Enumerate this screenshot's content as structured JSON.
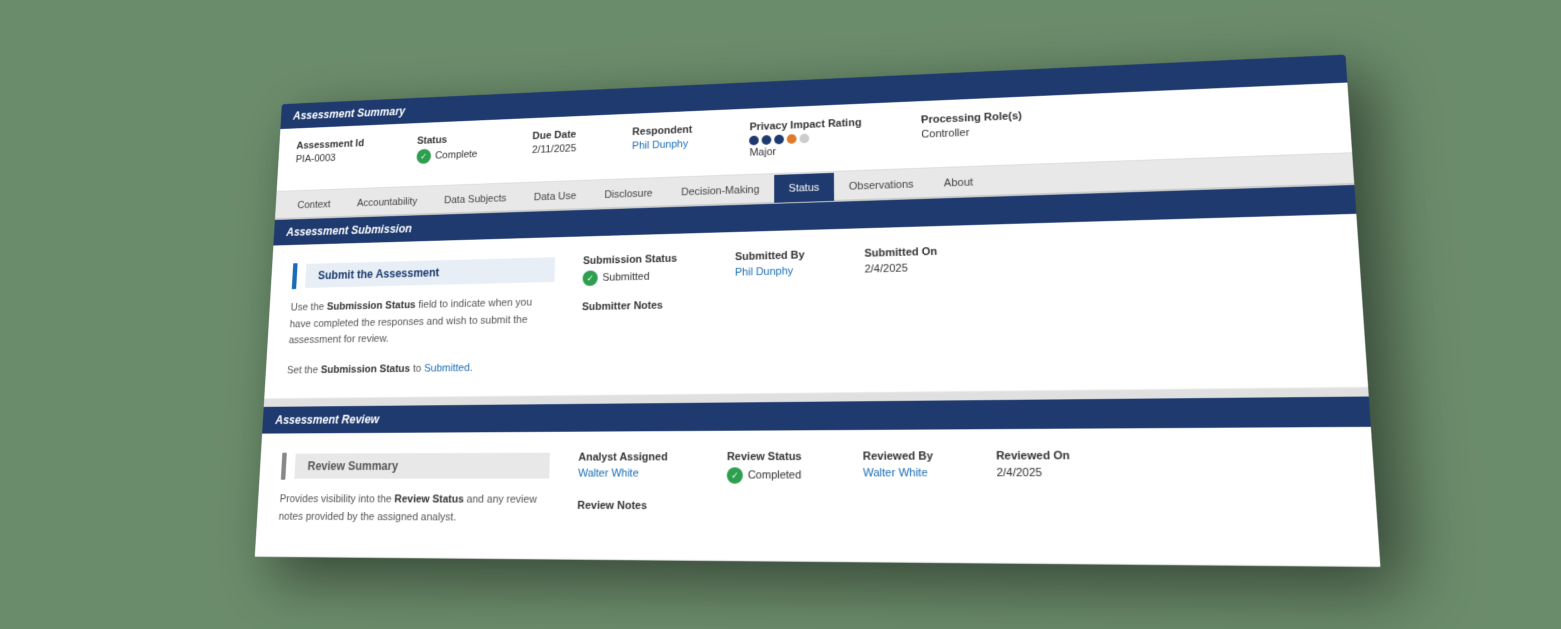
{
  "assessmentSummary": {
    "header": "Assessment Summary",
    "fields": {
      "assessmentId": {
        "label": "Assessment Id",
        "value": "PIA-0003"
      },
      "status": {
        "label": "Status",
        "value": "Complete"
      },
      "dueDate": {
        "label": "Due Date",
        "value": "2/11/2025"
      },
      "respondent": {
        "label": "Respondent",
        "value": "Phil Dunphy"
      },
      "privacyImpactRating": {
        "label": "Privacy Impact Rating",
        "ratingText": "Major",
        "dots": [
          "filled",
          "filled",
          "filled",
          "orange",
          "empty",
          "empty"
        ]
      },
      "processingRoles": {
        "label": "Processing Role(s)",
        "value": "Controller"
      }
    }
  },
  "navigation": {
    "tabs": [
      {
        "label": "Context",
        "active": false
      },
      {
        "label": "Accountability",
        "active": false
      },
      {
        "label": "Data Subjects",
        "active": false
      },
      {
        "label": "Data Use",
        "active": false
      },
      {
        "label": "Disclosure",
        "active": false
      },
      {
        "label": "Decision-Making",
        "active": false
      },
      {
        "label": "Status",
        "active": true
      },
      {
        "label": "Observations",
        "active": false
      },
      {
        "label": "About",
        "active": false
      }
    ]
  },
  "assessmentSubmission": {
    "header": "Assessment Submission",
    "panelTitle": "Submit the Assessment",
    "description1": "Use the ",
    "descriptionBold1": "Submission Status",
    "description2": " field to indicate when you have completed the responses and wish to submit the assessment for review.",
    "description3": "Set the ",
    "descriptionBold2": "Submission Status",
    "description4": " to ",
    "descriptionLink": "Submitted",
    "description5": ".",
    "submissionStatus": {
      "label": "Submission Status",
      "value": "Submitted"
    },
    "submittedBy": {
      "label": "Submitted By",
      "value": "Phil Dunphy"
    },
    "submittedOn": {
      "label": "Submitted On",
      "value": "2/4/2025"
    },
    "submitterNotes": {
      "label": "Submitter Notes"
    }
  },
  "assessmentReview": {
    "header": "Assessment Review",
    "panelTitle": "Review Summary",
    "description1": "Provides visibility into the ",
    "descriptionBold": "Review Status",
    "description2": " and any review notes provided by the assigned analyst.",
    "analystAssigned": {
      "label": "Analyst Assigned",
      "value": "Walter White"
    },
    "reviewStatus": {
      "label": "Review Status",
      "value": "Completed"
    },
    "reviewedBy": {
      "label": "Reviewed By",
      "value": "Walter White"
    },
    "reviewedOn": {
      "label": "Reviewed On",
      "value": "2/4/2025"
    },
    "reviewNotes": {
      "label": "Review Notes"
    }
  },
  "colors": {
    "headerBg": "#1e3a6e",
    "activeTab": "#1e3a6e",
    "linkColor": "#1a6db5",
    "checkGreen": "#2e9e4f",
    "dot1": "#1e3a6e",
    "dot2": "#1e3a6e",
    "dot3": "#1e3a6e",
    "dot4": "#e07b2a",
    "dot5": "#ccc"
  }
}
